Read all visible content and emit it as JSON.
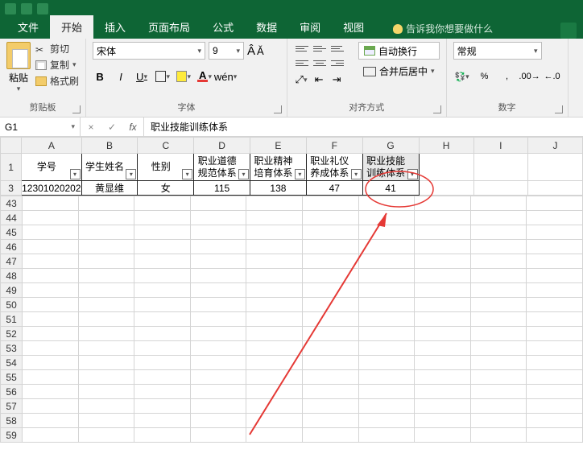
{
  "tabs": {
    "file": "文件",
    "home": "开始",
    "insert": "插入",
    "layout": "页面布局",
    "formulas": "公式",
    "data": "数据",
    "review": "审阅",
    "view": "视图",
    "tellme": "告诉我你想要做什么"
  },
  "ribbon": {
    "clipboard": {
      "paste": "粘贴",
      "cut": "剪切",
      "copy": "复制",
      "format_painter": "格式刷",
      "group": "剪贴板"
    },
    "font": {
      "name": "宋体",
      "size": "9",
      "group": "字体"
    },
    "align": {
      "wrap": "自动换行",
      "merge": "合并后居中",
      "group": "对齐方式"
    },
    "number": {
      "format": "常规",
      "group": "数字"
    }
  },
  "namebox": "G1",
  "formula": "职业技能训练体系",
  "columns": [
    "A",
    "B",
    "C",
    "D",
    "E",
    "F",
    "G",
    "H",
    "I",
    "J"
  ],
  "row_headers_top": [
    "1",
    "3"
  ],
  "row_headers_rest": [
    "43",
    "44",
    "45",
    "46",
    "47",
    "48",
    "49",
    "50",
    "51",
    "52",
    "53",
    "54",
    "55",
    "56",
    "57",
    "58",
    "59"
  ],
  "headers": {
    "A": "学号",
    "B": "学生姓名",
    "C": "性别",
    "D": "职业道德规范体系",
    "E": "职业精神培育体系",
    "F": "职业礼仪养成体系",
    "G": "职业技能训练体系"
  },
  "data_row": {
    "A": "12301020202",
    "B": "黄显维",
    "C": "女",
    "D": "115",
    "E": "138",
    "F": "47",
    "G": "41"
  }
}
